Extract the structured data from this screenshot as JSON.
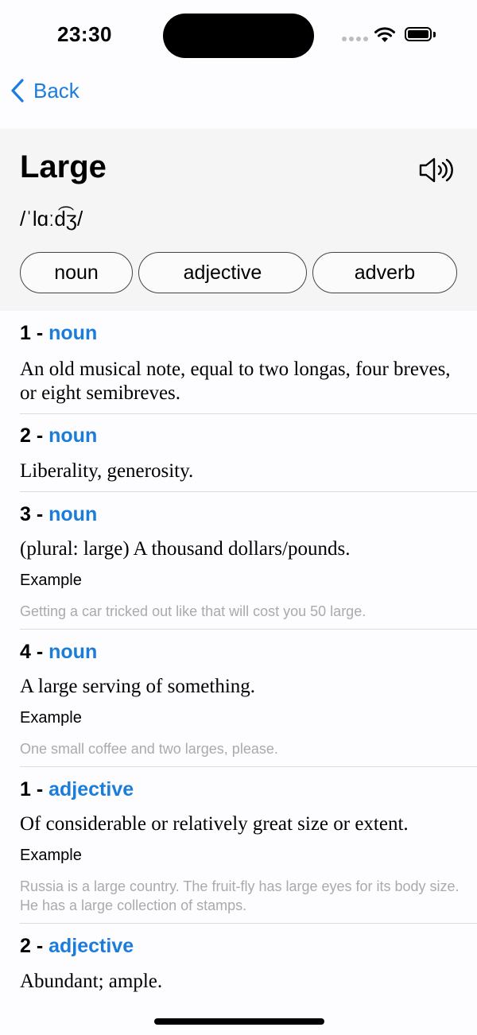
{
  "status": {
    "time": "23:30"
  },
  "nav": {
    "back_label": "Back"
  },
  "word": {
    "title": "Large",
    "phonetic": "/ˈlɑːd͡ʒ/",
    "pos_tabs": [
      "noun",
      "adjective",
      "adverb"
    ]
  },
  "entries": [
    {
      "num": "1 - ",
      "pos": "noun",
      "definition": "An old musical note, equal to two longas, four breves, or eight semibreves."
    },
    {
      "num": "2 - ",
      "pos": "noun",
      "definition": "Liberality, generosity."
    },
    {
      "num": "3 - ",
      "pos": "noun",
      "definition": "(plural: large) A thousand dollars/pounds.",
      "example_label": "Example",
      "example": "Getting a car tricked out like that will cost you 50 large."
    },
    {
      "num": "4 - ",
      "pos": "noun",
      "definition": "A large serving of something.",
      "example_label": "Example",
      "example": "One small coffee and two larges, please."
    },
    {
      "num": "1 - ",
      "pos": "adjective",
      "definition": "Of considerable or relatively great size or extent.",
      "example_label": "Example",
      "example": "Russia is a large country.   The fruit-fly has large eyes for its body size.   He has a large collection of stamps."
    },
    {
      "num": "2 - ",
      "pos": "adjective",
      "definition": "Abundant; ample."
    }
  ],
  "colors": {
    "accent": "#1a7ddb",
    "example_text": "#aaaaaa",
    "header_bg": "#f5f5f6"
  }
}
